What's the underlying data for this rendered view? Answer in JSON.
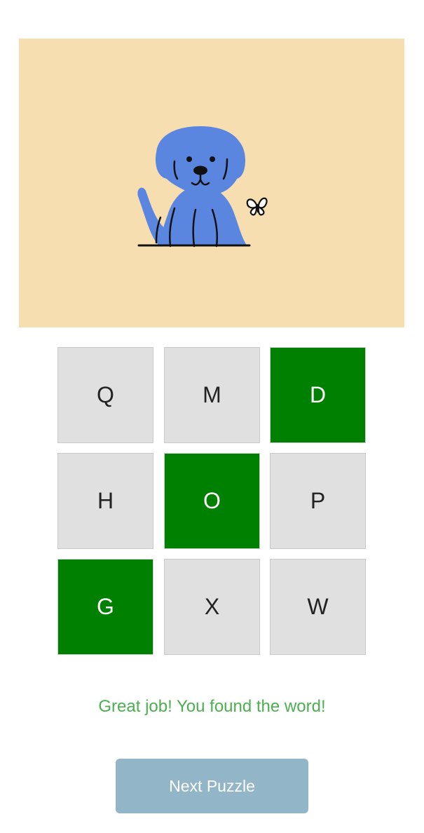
{
  "puzzle": {
    "image_subject": "dog",
    "image_background": "#f7deb0",
    "image_figure_color": "#5b86e0",
    "tiles": [
      {
        "letter": "Q",
        "state": "default"
      },
      {
        "letter": "M",
        "state": "default"
      },
      {
        "letter": "D",
        "state": "found"
      },
      {
        "letter": "H",
        "state": "default"
      },
      {
        "letter": "O",
        "state": "found"
      },
      {
        "letter": "P",
        "state": "default"
      },
      {
        "letter": "G",
        "state": "found"
      },
      {
        "letter": "X",
        "state": "default"
      },
      {
        "letter": "W",
        "state": "default"
      }
    ]
  },
  "colors": {
    "tile_default": "#e0e0e0",
    "tile_found": "#008000",
    "message": "#4caf50",
    "button": "#92b5c8"
  },
  "status": {
    "message": "Great job! You found the word!"
  },
  "actions": {
    "next_label": "Next Puzzle"
  }
}
